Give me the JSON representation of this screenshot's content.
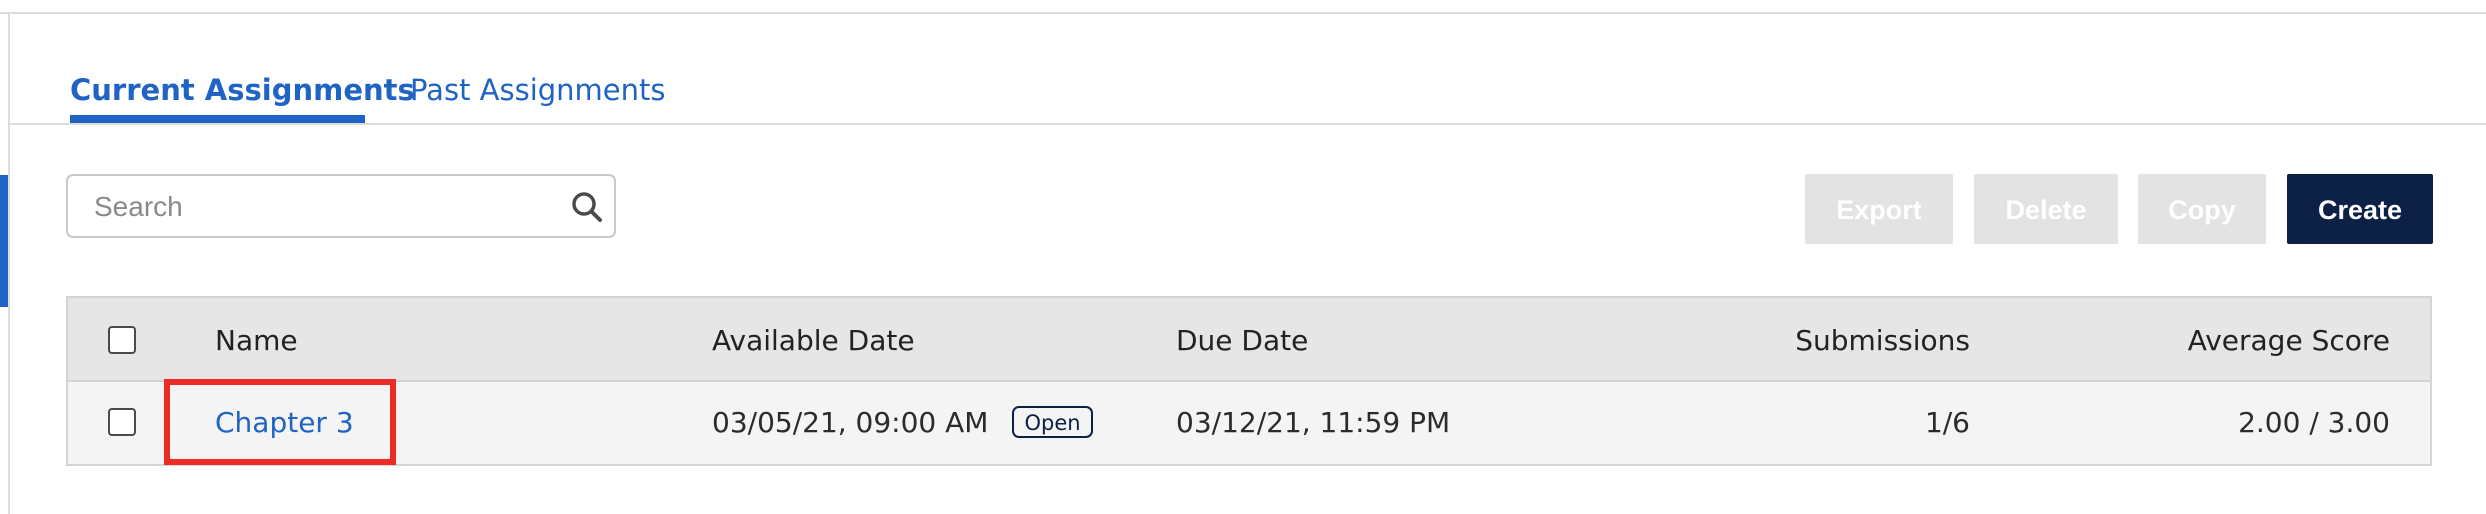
{
  "tabs": {
    "current": "Current Assignments",
    "past": "Past Assignments"
  },
  "search": {
    "placeholder": "Search",
    "value": ""
  },
  "toolbar": {
    "export": "Export",
    "delete": "Delete",
    "copy": "Copy",
    "create": "Create"
  },
  "table": {
    "headers": {
      "name": "Name",
      "available": "Available Date",
      "due": "Due Date",
      "submissions": "Submissions",
      "average": "Average Score"
    },
    "rows": [
      {
        "name": "Chapter 3",
        "available": "03/05/21, 09:00 AM",
        "status": "Open",
        "due": "03/12/21, 11:59 PM",
        "submissions": "1/6",
        "average": "2.00 / 3.00"
      }
    ]
  },
  "colors": {
    "accent": "#1f63c4",
    "primary_button": "#0c1f45",
    "disabled_button": "#e3e3e3",
    "highlight": "#ee2a24"
  },
  "icons": {
    "search": "search-icon"
  }
}
